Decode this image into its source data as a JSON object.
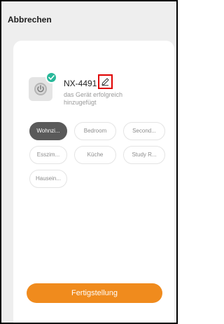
{
  "header": {
    "cancel_label": "Abbrechen"
  },
  "device": {
    "name": "NX-4491",
    "status_line1": "das Gerät erfolgreich",
    "status_line2": "hinzugefügt",
    "success_color": "#29b89a"
  },
  "rooms": [
    {
      "label": "Wohnzi...",
      "selected": true
    },
    {
      "label": "Bedroom",
      "selected": false
    },
    {
      "label": "Second...",
      "selected": false
    },
    {
      "label": "Esszim...",
      "selected": false
    },
    {
      "label": "Küche",
      "selected": false
    },
    {
      "label": "Study R...",
      "selected": false
    },
    {
      "label": "Hausein...",
      "selected": false
    }
  ],
  "actions": {
    "finish_label": "Fertigstellung",
    "accent_color": "#f08b1d"
  },
  "icons": {
    "device": "power-icon",
    "success": "check-icon",
    "edit": "pencil-icon"
  }
}
